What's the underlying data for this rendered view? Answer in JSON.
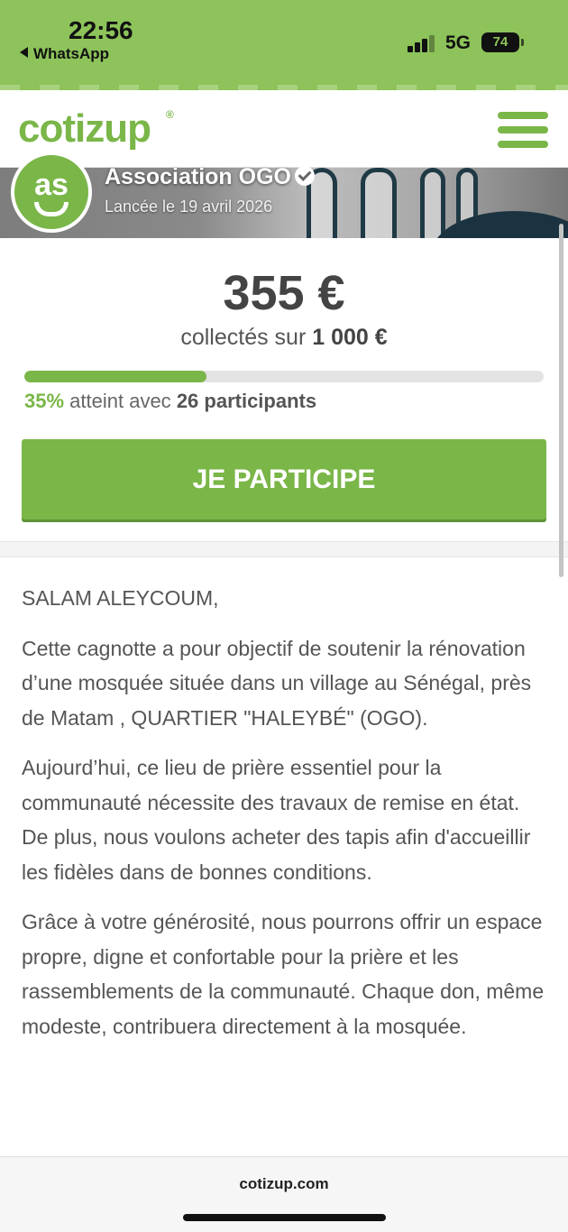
{
  "status_bar": {
    "time": "22:56",
    "back_app": "WhatsApp",
    "network": "5G",
    "battery": "74"
  },
  "header": {
    "logo_text": "cotizup",
    "logo_mark": "®",
    "menu_icon": "hamburger-menu-icon"
  },
  "campaign": {
    "avatar_text": "as",
    "organizer": "Association OGO",
    "launch_date": "Lancée le 19 avril 2026",
    "amount": "355 €",
    "collected_prefix": "collectés sur",
    "goal": "1 000 €",
    "progress_percent": 35,
    "progress_pct_label": "35%",
    "progress_mid": "atteint avec",
    "participants": "26 participants",
    "cta_label": "JE PARTICIPE"
  },
  "description": {
    "paragraphs": [
      "SALAM ALEYCOUM,",
      "Cette cagnotte a pour objectif de soutenir la rénovation d’une mosquée située dans un village au Sénégal, près de Matam , QUARTIER \"HALEYBÉ\" (OGO).",
      "Aujourd’hui, ce lieu de prière essentiel pour la communauté nécessite des travaux de remise en état. De plus, nous voulons acheter des tapis afin d'accueillir les fidèles dans de bonnes conditions.",
      "Grâce à votre générosité, nous pourrons offrir un espace propre, digne et confortable pour la prière et les rassemblements de la communauté. Chaque don, même modeste, contribuera directement à la mosquée."
    ]
  },
  "browser": {
    "url": "cotizup.com"
  },
  "colors": {
    "brand_green": "#7ab648",
    "status_bar_green": "#8dc35a",
    "text_gray": "#555555"
  }
}
